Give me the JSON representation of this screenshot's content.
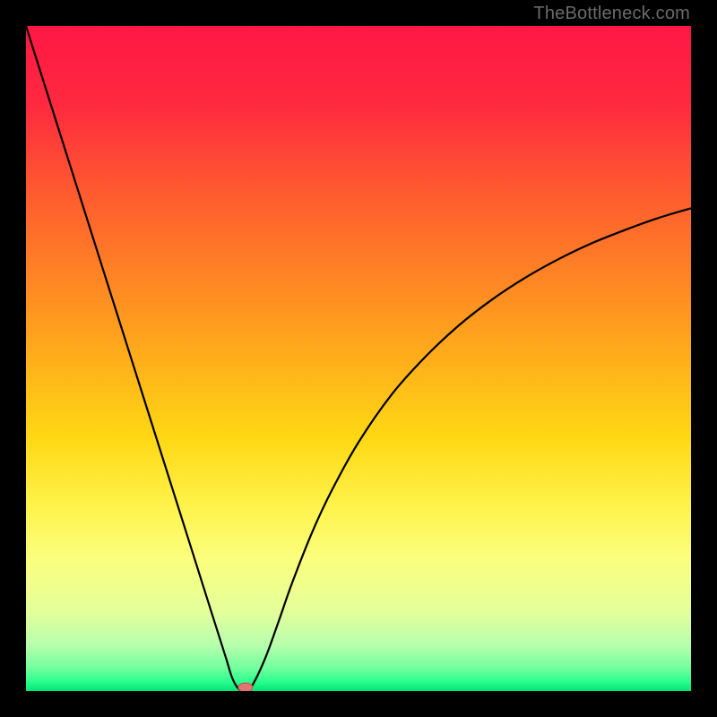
{
  "watermark": "TheBottleneck.com",
  "chart_data": {
    "type": "line",
    "title": "",
    "xlabel": "",
    "ylabel": "",
    "xlim": [
      0,
      100
    ],
    "ylim": [
      0,
      100
    ],
    "series": [
      {
        "name": "curve",
        "x": [
          0,
          5,
          10,
          15,
          20,
          25,
          28,
          30,
          31,
          32,
          33,
          34,
          36,
          38,
          40,
          43,
          46,
          50,
          55,
          60,
          65,
          70,
          75,
          80,
          85,
          90,
          95,
          100
        ],
        "values": [
          100,
          84.2,
          68.4,
          52.6,
          36.8,
          21.0,
          11.5,
          5.2,
          2.0,
          0.3,
          0.0,
          0.8,
          5.0,
          10.5,
          16.2,
          23.8,
          30.2,
          37.4,
          44.6,
          50.2,
          54.9,
          58.8,
          62.1,
          64.9,
          67.3,
          69.3,
          71.1,
          72.6
        ]
      }
    ],
    "minimum_marker": {
      "x": 33,
      "y": 0
    },
    "background_gradient": {
      "stops": [
        {
          "pos": 0.0,
          "color": "#ff1744"
        },
        {
          "pos": 0.12,
          "color": "#ff2a3f"
        },
        {
          "pos": 0.25,
          "color": "#ff5a2f"
        },
        {
          "pos": 0.38,
          "color": "#ff8524"
        },
        {
          "pos": 0.5,
          "color": "#ffae1a"
        },
        {
          "pos": 0.62,
          "color": "#ffd814"
        },
        {
          "pos": 0.72,
          "color": "#fff24a"
        },
        {
          "pos": 0.8,
          "color": "#fbff7d"
        },
        {
          "pos": 0.88,
          "color": "#e4ff9a"
        },
        {
          "pos": 0.93,
          "color": "#b8ffad"
        },
        {
          "pos": 0.965,
          "color": "#74ff9e"
        },
        {
          "pos": 0.985,
          "color": "#2eff8e"
        },
        {
          "pos": 1.0,
          "color": "#00e676"
        }
      ]
    }
  }
}
